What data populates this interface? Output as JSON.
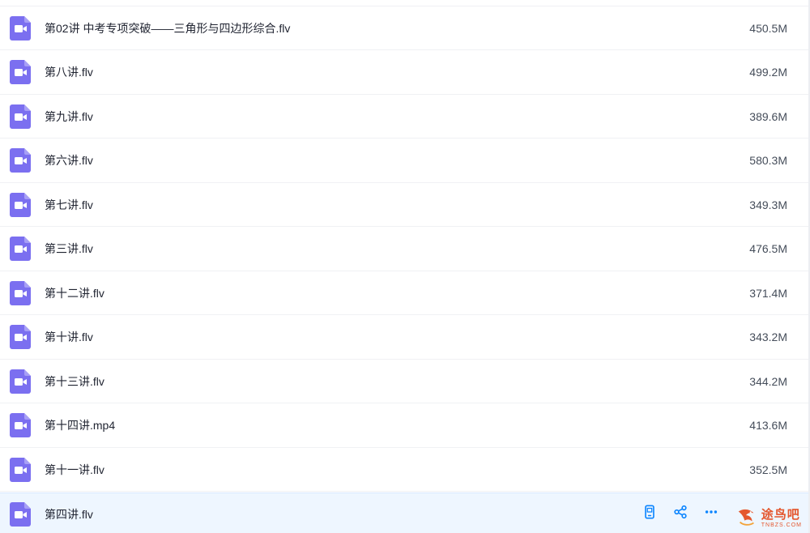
{
  "files": [
    {
      "name": "第02讲 中考专项突破——三角形与四边形综合.flv",
      "size": "450.5M",
      "icon": "video-file-icon"
    },
    {
      "name": "第八讲.flv",
      "size": "499.2M",
      "icon": "video-file-icon"
    },
    {
      "name": "第九讲.flv",
      "size": "389.6M",
      "icon": "video-file-icon"
    },
    {
      "name": "第六讲.flv",
      "size": "580.3M",
      "icon": "video-file-icon"
    },
    {
      "name": "第七讲.flv",
      "size": "349.3M",
      "icon": "video-file-icon"
    },
    {
      "name": "第三讲.flv",
      "size": "476.5M",
      "icon": "video-file-icon"
    },
    {
      "name": "第十二讲.flv",
      "size": "371.4M",
      "icon": "video-file-icon"
    },
    {
      "name": "第十讲.flv",
      "size": "343.2M",
      "icon": "video-file-icon"
    },
    {
      "name": "第十三讲.flv",
      "size": "344.2M",
      "icon": "video-file-icon"
    },
    {
      "name": "第十四讲.mp4",
      "size": "413.6M",
      "icon": "video-file-icon"
    },
    {
      "name": "第十一讲.flv",
      "size": "352.5M",
      "icon": "video-file-icon"
    },
    {
      "name": "第四讲.flv",
      "size": "",
      "icon": "video-file-icon",
      "hovered": true
    }
  ],
  "hover_actions": [
    {
      "name": "phone-icon",
      "label": "send to phone"
    },
    {
      "name": "share-icon",
      "label": "share"
    },
    {
      "name": "more-icon",
      "label": "more"
    }
  ],
  "watermark": {
    "main": "途鸟吧",
    "sub": "TNBZS.COM"
  },
  "colors": {
    "icon": "#7b6ff0",
    "action": "#0a84ff",
    "hover_bg": "#eef6ff",
    "watermark": "#e4572e"
  }
}
